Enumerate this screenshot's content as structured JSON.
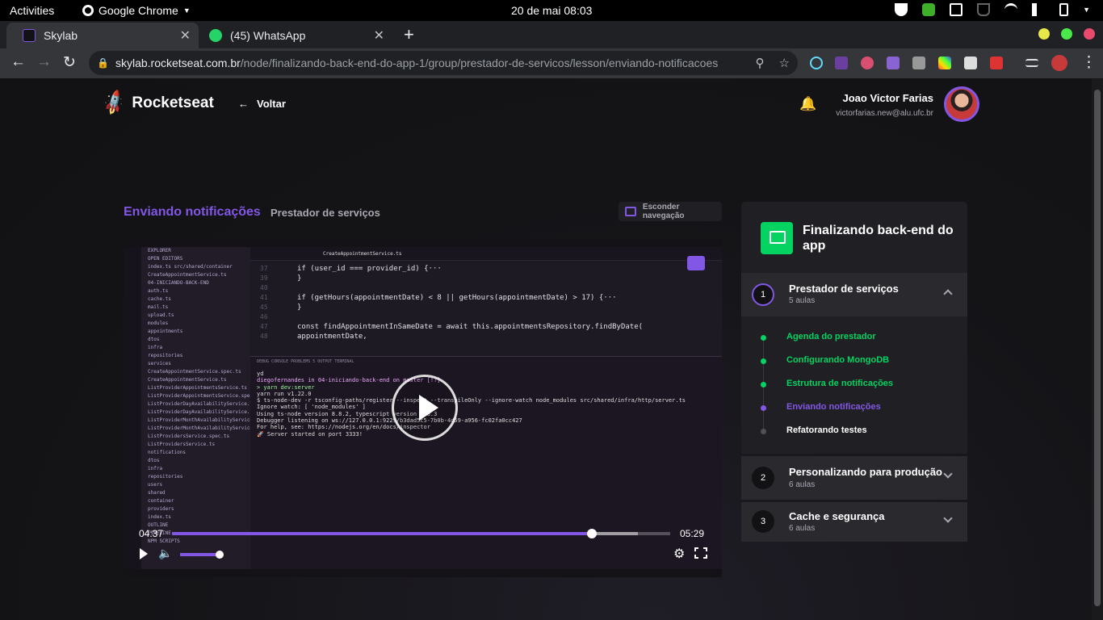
{
  "os_bar": {
    "activities": "Activities",
    "app_name": "Google Chrome",
    "clock": "20 de mai  08:03"
  },
  "browser": {
    "tabs": [
      {
        "label": "Skylab",
        "active": true
      },
      {
        "label": "(45) WhatsApp",
        "active": false
      }
    ],
    "url_host": "skylab.rocketseat.com.br",
    "url_path": "/node/finalizando-back-end-do-app-1/group/prestador-de-servicos/lesson/enviando-notificacoes"
  },
  "header": {
    "logo": "Rocketseat",
    "back_label": "Voltar",
    "user_name": "Joao Victor Farias",
    "user_email": "victorfarias.new@alu.ufc.br"
  },
  "lesson": {
    "title": "Enviando notificações",
    "group": "Prestador de serviços",
    "hide_nav_label": "Esconder navegação"
  },
  "video": {
    "current_time": "04:37",
    "duration": "05:29",
    "played_fraction": 0.842,
    "buffered_fraction": 0.935,
    "volume_fraction": 1.0,
    "editor_tab": "CreateAppointmentService.ts",
    "code_lines": [
      {
        "n": "37",
        "text": "if (user_id === provider_id) {···"
      },
      {
        "n": "39",
        "text": "}"
      },
      {
        "n": "40",
        "text": ""
      },
      {
        "n": "41",
        "text": "if (getHours(appointmentDate) < 8 || getHours(appointmentDate) > 17) {···"
      },
      {
        "n": "45",
        "text": "}"
      },
      {
        "n": "46",
        "text": ""
      },
      {
        "n": "47",
        "text": "const findAppointmentInSameDate = await this.appointmentsRepository.findByDate("
      },
      {
        "n": "48",
        "text": "  appointmentDate,"
      }
    ],
    "terminal_tabs": "DEBUG CONSOLE    PROBLEMS  5    OUTPUT    TERMINAL",
    "terminal_lines": [
      "yd",
      "diegofernandes in 04-iniciando-back-end on  master [!?]",
      "> yarn dev:server",
      "yarn run v1.22.0",
      "$ ts-node-dev -r tsconfig-paths/register --inspect --transpileOnly --ignore-watch node_modules src/shared/infra/http/server.ts",
      "Ignore watch: [ 'node_modules' ]",
      "Using ts-node version 8.8.2, typescript version 3.8.3",
      "Debugger listening on ws://127.0.0.1:9229/b3dad5c5-7b0b-4d59-a956-fc02fa0cc427",
      "For help, see: https://nodejs.org/en/docs/inspector",
      "🚀 Server started on port 3333!"
    ],
    "explorer_items": [
      "EXPLORER",
      "OPEN EDITORS",
      "index.ts src/shared/container",
      "CreateAppointmentService.ts",
      "04-INICIANDO-BACK-END",
      "auth.ts",
      "cache.ts",
      "mail.ts",
      "upload.ts",
      "modules",
      "appointments",
      "dtos",
      "infra",
      "repositories",
      "services",
      "CreateAppointmentService.spec.ts",
      "CreateAppointmentService.ts",
      "ListProviderAppointmentsService.ts",
      "ListProviderAppointmentsService.spec.ts",
      "ListProviderDayAvailabilityService.ts",
      "ListProviderDayAvailabilityService.spec.ts",
      "ListProviderMonthAvailabilityService.ts",
      "ListProviderMonthAvailabilityService.spec.ts",
      "ListProvidersService.spec.ts",
      "ListProvidersService.ts",
      "notifications",
      "dtos",
      "infra",
      "repositories",
      "users",
      "shared",
      "container",
      "providers",
      "index.ts",
      "OUTLINE",
      "TIMELINE",
      "NPM SCRIPTS"
    ]
  },
  "course": {
    "title": "Finalizando back-end do app",
    "modules": [
      {
        "num": "1",
        "title": "Prestador de serviços",
        "count": "5 aulas",
        "expanded": true
      },
      {
        "num": "2",
        "title": "Personalizando para produção",
        "count": "6 aulas",
        "expanded": false
      },
      {
        "num": "3",
        "title": "Cache e segurança",
        "count": "6 aulas",
        "expanded": false
      }
    ],
    "lessons": [
      {
        "label": "Agenda do prestador",
        "status": "done"
      },
      {
        "label": "Configurando MongoDB",
        "status": "done"
      },
      {
        "label": "Estrutura de notificações",
        "status": "done"
      },
      {
        "label": "Enviando notificações",
        "status": "current"
      },
      {
        "label": "Refatorando testes",
        "status": "pending"
      }
    ]
  },
  "colors": {
    "accent": "#8257e5",
    "done": "#04d361",
    "pending": "#505059"
  }
}
